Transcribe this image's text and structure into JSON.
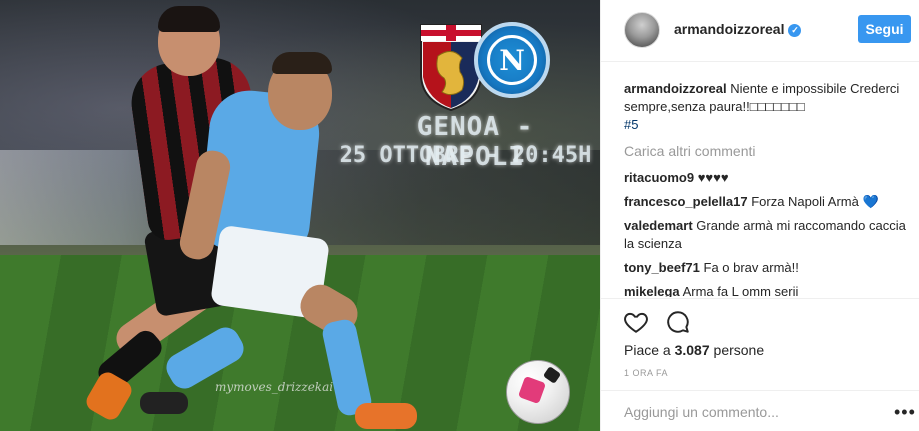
{
  "post": {
    "watermark": "mymoves_drizzekai",
    "title": "GENOA - NAPOLI",
    "subtitle": "25 OTTOBRE - 20:45H",
    "napoli_letter": "N"
  },
  "header": {
    "username": "armandoizzoreal",
    "verified_mark": "✓",
    "follow_label": "Segui"
  },
  "caption": {
    "username": "armandoizzoreal",
    "text": "Niente e impossibile Crederci sempre,senza paura!!□□□□□□□",
    "hashtag": "#5"
  },
  "load_more": "Carica altri commenti",
  "comments": [
    {
      "user": "ritacuomo9",
      "text": "♥♥♥♥"
    },
    {
      "user": "francesco_pelella17",
      "text": "Forza Napoli Armà 💙"
    },
    {
      "user": "valedemart",
      "text": "Grande armà mi raccomando caccia la scienza"
    },
    {
      "user": "tony_beef71",
      "text": "Fa o brav armà!!"
    },
    {
      "user": "mikelega",
      "text": "Arma fa L omm serii"
    }
  ],
  "likes": {
    "prefix": "Piace a",
    "count": "3.087",
    "suffix": "persone"
  },
  "time": "1 ORA FA",
  "add_comment_placeholder": "Aggiungi un commento...",
  "more_label": "•••",
  "colors": {
    "accent": "#3897f0",
    "muted": "#999999",
    "hashtag": "#003569"
  }
}
